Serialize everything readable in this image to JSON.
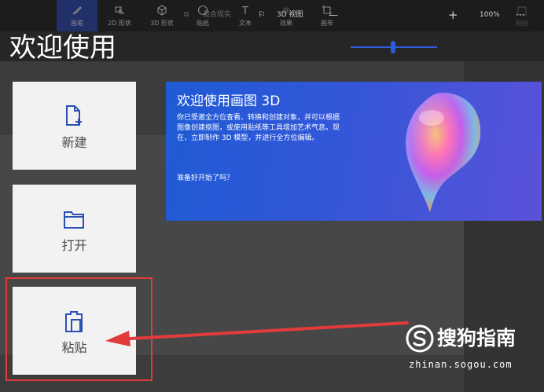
{
  "toolbar": {
    "tools": [
      {
        "label": "画笔",
        "icon": "brush-icon",
        "active": true
      },
      {
        "label": "2D 形状",
        "icon": "shape-2d-icon"
      },
      {
        "label": "3D 形状",
        "icon": "cube-icon"
      },
      {
        "label": "贴纸",
        "icon": "sticker-icon"
      },
      {
        "label": "文本",
        "icon": "text-icon"
      },
      {
        "label": "效果",
        "icon": "effects-icon"
      },
      {
        "label": "画布",
        "icon": "canvas-icon"
      }
    ],
    "right_label": "粘贴"
  },
  "subbar": {
    "mixed_reality": "混合现实",
    "view_3d": "3D 视图",
    "zoom_minus": "—",
    "zoom_plus": "+",
    "zoom_level": "100%",
    "more": "···"
  },
  "welcome": {
    "title": "欢迎使用",
    "tiles": [
      {
        "label": "新建",
        "icon": "new-file-icon"
      },
      {
        "label": "打开",
        "icon": "folder-icon"
      },
      {
        "label": "粘贴",
        "icon": "clipboard-icon"
      }
    ]
  },
  "banner": {
    "title": "欢迎使用画图 3D",
    "body": "你已受邀全方位查看、转换和创建对象，并可以根据图像创建抠图，或使用贴纸等工具增加艺术气息。现在，立即制作 3D 模型，并进行全方位编辑。",
    "question": "准备好开始了吗？"
  },
  "watermark": {
    "brand": "搜狗指南",
    "url": "zhinan.sogou.com"
  },
  "colors": {
    "accent": "#2f5bd8",
    "highlight": "#e23b3b",
    "banner_start": "#1f5bd6",
    "banner_end": "#5a52d9"
  }
}
